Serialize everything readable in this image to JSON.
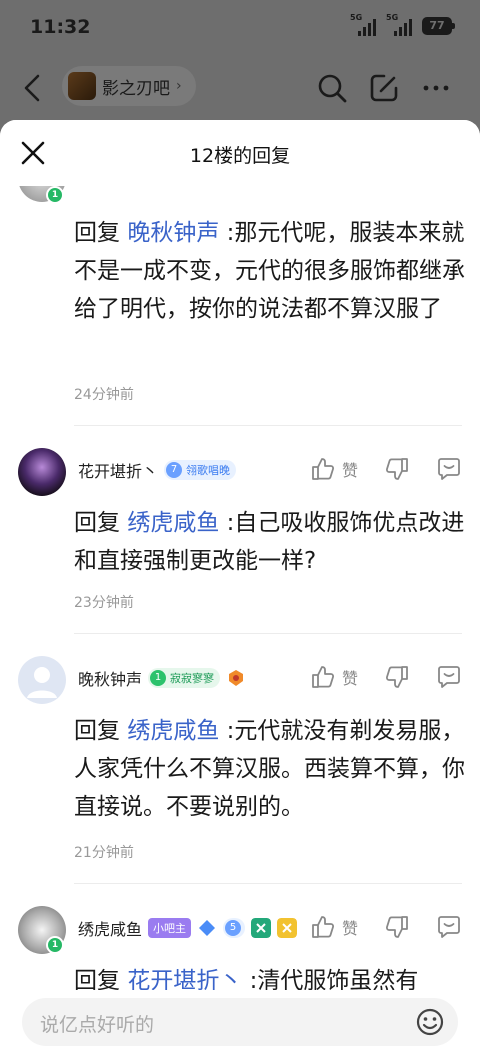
{
  "status_bar": {
    "time": "11:32",
    "sim1": "5G",
    "sim2": "5G",
    "battery": "77"
  },
  "nav": {
    "forum_name": "影之刃吧",
    "chevron": "›"
  },
  "sheet": {
    "title": "12楼的回复"
  },
  "replies": [
    {
      "username": "",
      "badge_level": "",
      "badge_text": "",
      "reply_prefix": "回复",
      "reply_to": "晚秋钟声",
      "text": ":那元代呢，服装本来就不是一成不变，元代的很多服饰都继承给了明代，按你的说法都不算汉服了",
      "time": "24分钟前"
    },
    {
      "username": "花开堪折丶",
      "badge_level": "7",
      "badge_text": "翎歌唱晚",
      "like_label": "赞",
      "reply_prefix": "回复",
      "reply_to": "绣虎咸鱼",
      "text": ":自己吸收服饰优点改进和直接强制更改能一样?",
      "time": "23分钟前"
    },
    {
      "username": "晚秋钟声",
      "badge_level": "1",
      "badge_text": "寂寂寥寥",
      "like_label": "赞",
      "reply_prefix": "回复",
      "reply_to": "绣虎咸鱼",
      "text": ":元代就没有剃发易服，人家凭什么不算汉服。西装算不算，你直接说。不要说别的。",
      "time": "21分钟前"
    },
    {
      "username": "绣虎咸鱼",
      "mod_badge": "小吧主",
      "badge_level": "5",
      "avatar_level": "1",
      "like_label": "赞",
      "reply_prefix": "回复",
      "reply_to": "花开堪折丶",
      "text": ":清代服饰虽然有"
    }
  ],
  "input": {
    "placeholder": "说亿点好听的"
  },
  "colors": {
    "link": "#3a63c9",
    "level_green": "#25b865",
    "mod_purple": "#9a7cf0"
  }
}
